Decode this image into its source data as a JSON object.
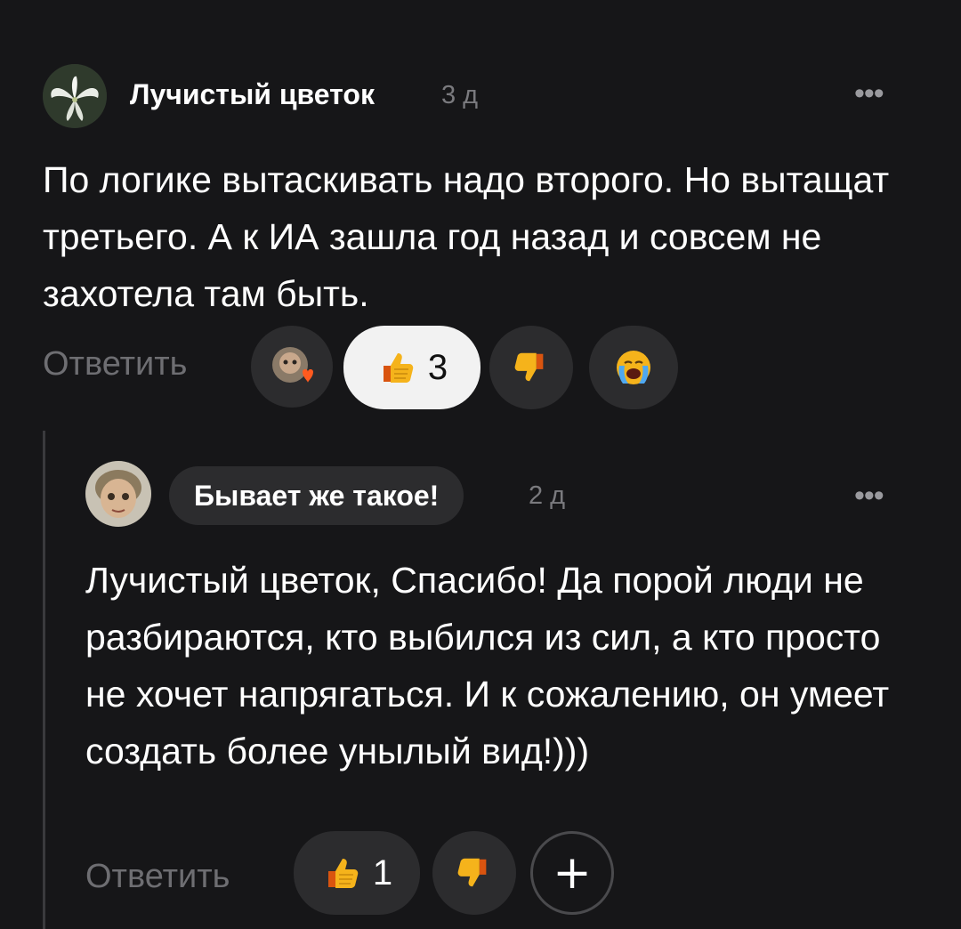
{
  "comment1": {
    "author": "Лучистый цветок",
    "time": "3 д",
    "menu_icon": "more-dots-icon",
    "text": "По логике вытаскивать надо второго. Но вытащат третьего. А к ИА зашла год назад и совсем не захотела там быть.",
    "reply_label": "Ответить",
    "reactions": {
      "like_count": "3",
      "icons": [
        "reactor-avatar-heart-icon",
        "thumbs-up-icon",
        "thumbs-down-icon",
        "crying-face-icon"
      ]
    }
  },
  "comment2": {
    "author": "Бывает же такое!",
    "time": "2 д",
    "menu_icon": "more-dots-icon",
    "text": "Лучистый цветок,  Спасибо! Да порой люди не разбираются, кто выбился из сил, а кто просто не хочет напрягаться. И к сожалению, он умеет создать более унылый вид!)))",
    "reply_label": "Ответить",
    "reactions": {
      "like_count": "1",
      "add_label": "+",
      "icons": [
        "thumbs-up-icon",
        "thumbs-down-icon",
        "plus-icon"
      ]
    }
  },
  "colors": {
    "background": "#161618",
    "chip": "#2c2c2e",
    "selected_pill": "#f2f2f2",
    "muted_text": "#6e6e72",
    "emoji_yellow": "#f5b31b"
  }
}
